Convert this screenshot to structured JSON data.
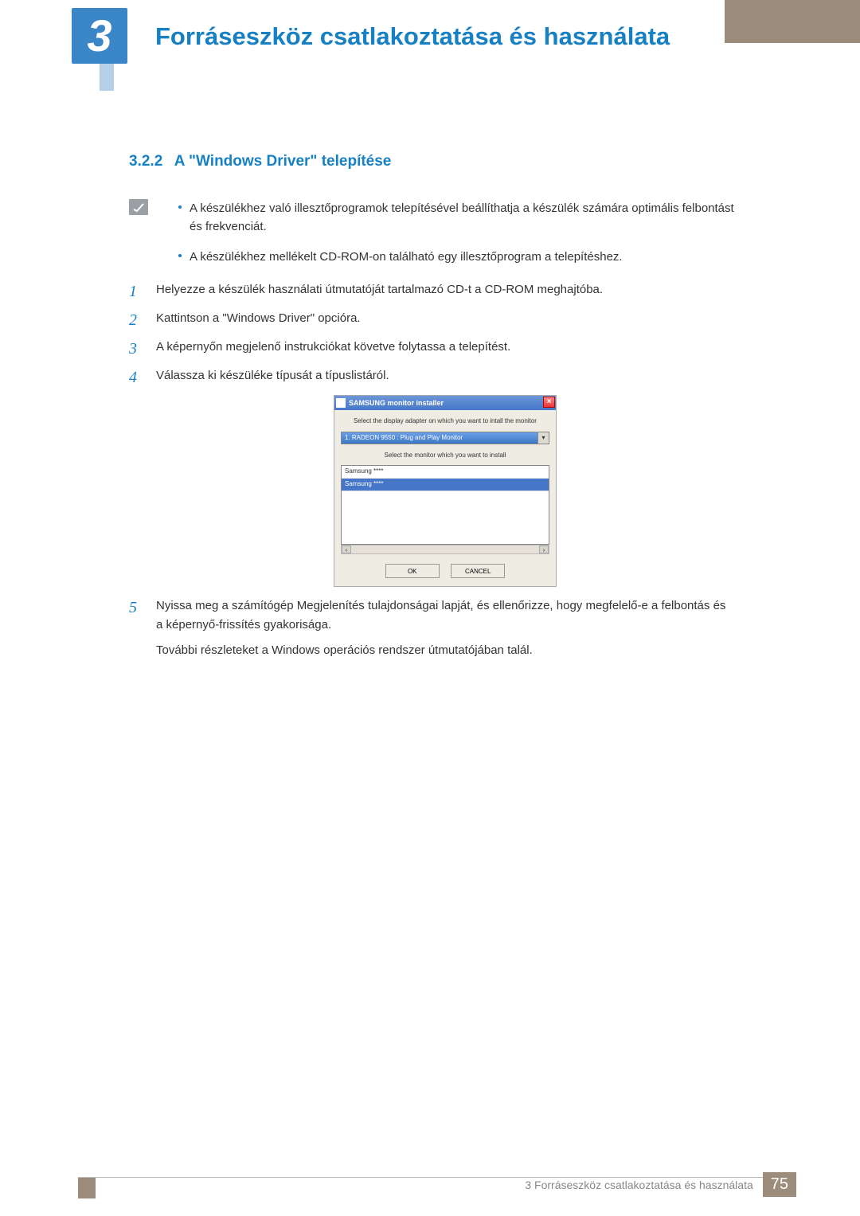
{
  "chapter": {
    "number": "3",
    "title": "Forráseszköz csatlakoztatása és használata"
  },
  "section": {
    "number": "3.2.2",
    "title": "A \"Windows Driver\" telepítése"
  },
  "notes": [
    "A készülékhez való illesztőprogramok telepítésével beállíthatja a készülék számára optimális felbontást és frekvenciát.",
    "A készülékhez mellékelt CD-ROM-on található egy illesztőprogram a telepítéshez."
  ],
  "steps": {
    "s1": "Helyezze a készülék használati útmutatóját tartalmazó CD-t a CD-ROM meghajtóba.",
    "s2": "Kattintson a \"Windows Driver\" opcióra.",
    "s3": "A képernyőn megjelenő instrukciókat követve folytassa a telepítést.",
    "s4": "Válassza ki készüléke típusát a típuslistáról.",
    "s5a": "Nyissa meg a számítógép Megjelenítés tulajdonságai lapját, és ellenőrizze, hogy megfelelő-e a felbontás és a képernyő-frissítés gyakorisága.",
    "s5b": "További részleteket a Windows operációs rendszer útmutatójában talál."
  },
  "installer": {
    "title": "SAMSUNG monitor installer",
    "instr1": "Select the display adapter on which you want to intall the monitor",
    "adapter": "1. RADEON 9550 : Plug and Play Monitor",
    "instr2": "Select the monitor which you want to install",
    "item1": "Samsung ****",
    "item2": "Samsung ****",
    "ok": "OK",
    "cancel": "CANCEL"
  },
  "footer": {
    "text": "3 Forráseszköz csatlakoztatása és használata",
    "page": "75"
  }
}
